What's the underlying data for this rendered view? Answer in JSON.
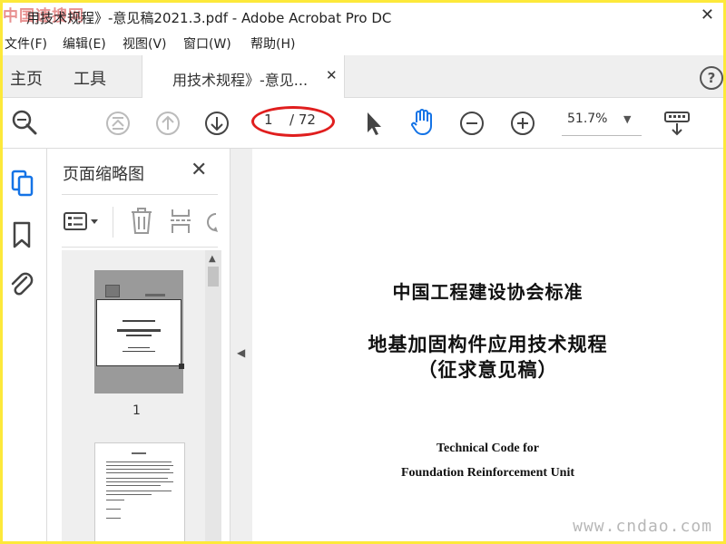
{
  "watermark_top": "中国速搜网",
  "window": {
    "title": "用技术规程》-意见稿2021.3.pdf - Adobe Acrobat Pro DC",
    "close_icon": "close-icon"
  },
  "menu": [
    "文件(F)",
    "编辑(E)",
    "视图(V)",
    "窗口(W)",
    "帮助(H)"
  ],
  "tabs": {
    "home": "主页",
    "tools": "工具",
    "document": "用技术规程》-意见...",
    "help": "?"
  },
  "toolbar": {
    "page_current": "1",
    "page_total": "/ 72",
    "zoom": "51.7%",
    "highlight_color": "#e01e1e",
    "accent_color": "#1473e6"
  },
  "thumbnails_panel": {
    "title": "页面缩略图",
    "page1_label": "1"
  },
  "document": {
    "line1": "中国工程建设协会标准",
    "line2": "地基加固构件应用技术规程",
    "line3": "（征求意见稿）",
    "line4": "Technical Code for",
    "line5": "Foundation Reinforcement Unit"
  },
  "watermark_bottom": "www.cndao.com"
}
